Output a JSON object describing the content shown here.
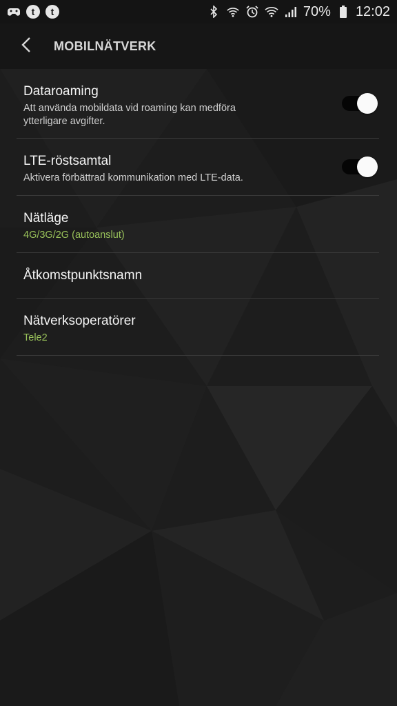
{
  "status_bar": {
    "battery_percent": "70%",
    "time": "12:02",
    "left_icons": [
      "game-controller-icon",
      "tumblr-icon",
      "tumblr-icon"
    ],
    "right_icons": [
      "bluetooth-icon",
      "wifi-calling-icon",
      "alarm-icon",
      "wifi-icon",
      "signal-icon",
      "battery-icon"
    ]
  },
  "app_bar": {
    "title": "MOBILNÄTVERK",
    "back_icon": "chevron-left-icon"
  },
  "settings": [
    {
      "title": "Dataroaming",
      "subtitle": "Att använda mobildata vid roaming kan medföra ytterligare avgifter.",
      "toggle_on": true
    },
    {
      "title": "LTE-röstsamtal",
      "subtitle": "Aktivera förbättrad kommunikation med LTE-data.",
      "toggle_on": true
    },
    {
      "title": "Nätläge",
      "value": "4G/3G/2G (autoanslut)"
    },
    {
      "title": "Åtkomstpunktsnamn"
    },
    {
      "title": "Nätverksoperatörer",
      "value": "Tele2"
    }
  ],
  "colors": {
    "accent_value": "#99c25a",
    "toggle_track": "#050505",
    "toggle_knob": "#fafafa",
    "background": "#1c1c1c"
  }
}
